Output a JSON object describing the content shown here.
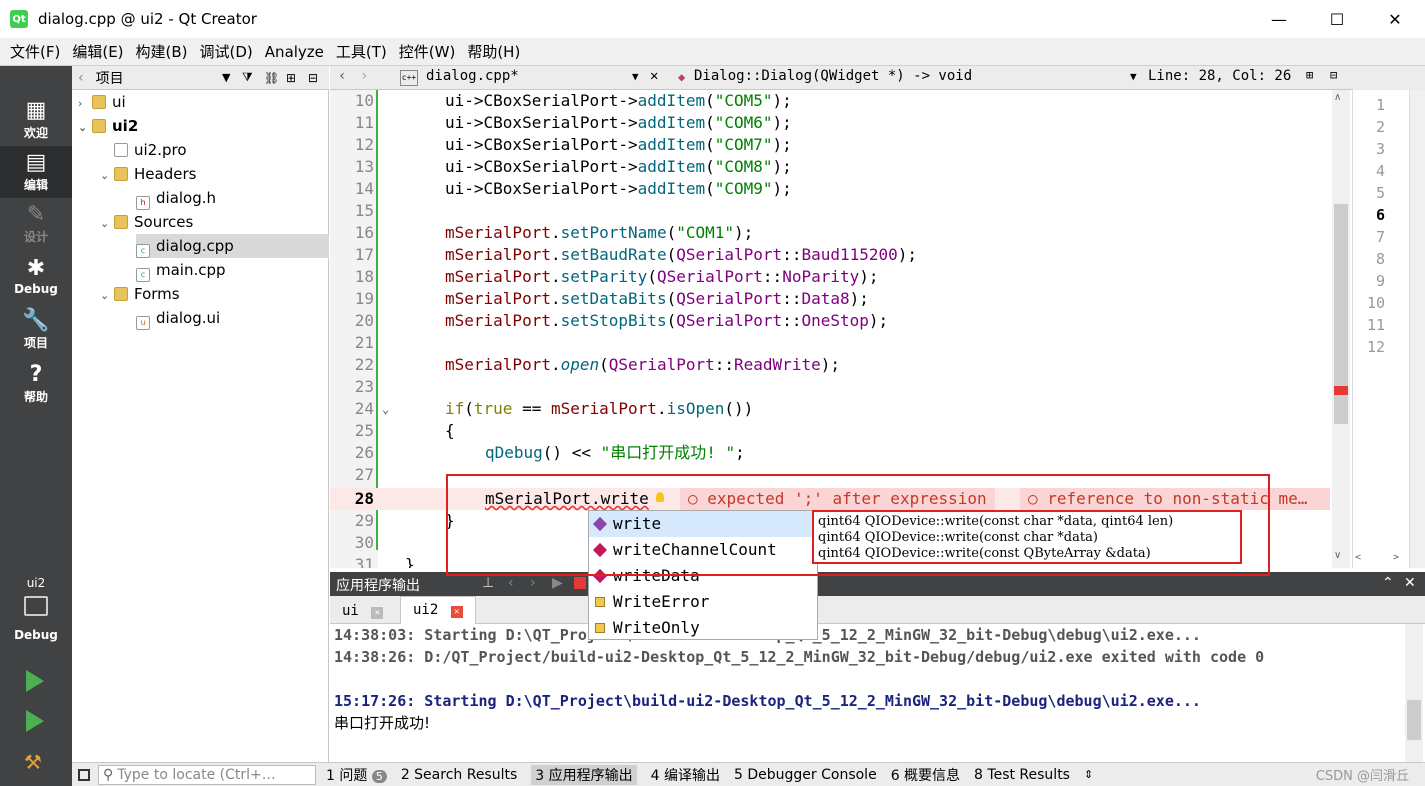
{
  "window": {
    "title": "dialog.cpp @ ui2 - Qt Creator",
    "logo_text": "Qt",
    "minimize": "—",
    "maximize": "☐",
    "close": "✕"
  },
  "menu": [
    "文件(F)",
    "编辑(E)",
    "构建(B)",
    "调试(D)",
    "Analyze",
    "工具(T)",
    "控件(W)",
    "帮助(H)"
  ],
  "modes": [
    {
      "icon": "▦",
      "label": "欢迎"
    },
    {
      "icon": "▤",
      "label": "编辑"
    },
    {
      "icon": "✎",
      "label": "设计"
    },
    {
      "icon": "✱",
      "label": "Debug"
    },
    {
      "icon": "🔧",
      "label": "项目"
    },
    {
      "icon": "?",
      "label": "帮助"
    }
  ],
  "kit": {
    "project": "ui2",
    "config": "Debug"
  },
  "project_panel": {
    "title": "项目"
  },
  "tree": [
    {
      "label": "ui",
      "arrow": "›",
      "type": "folder"
    },
    {
      "label": "ui2",
      "arrow": "⌄",
      "type": "folder"
    },
    {
      "label": "ui2.pro",
      "arrow": "",
      "type": "pro"
    },
    {
      "label": "Headers",
      "arrow": "⌄",
      "type": "folder"
    },
    {
      "label": "dialog.h",
      "arrow": "",
      "type": "h"
    },
    {
      "label": "Sources",
      "arrow": "⌄",
      "type": "folder"
    },
    {
      "label": "dialog.cpp",
      "arrow": "",
      "type": "cpp"
    },
    {
      "label": "main.cpp",
      "arrow": "",
      "type": "cpp"
    },
    {
      "label": "Forms",
      "arrow": "⌄",
      "type": "folder"
    },
    {
      "label": "dialog.ui",
      "arrow": "",
      "type": "ui"
    }
  ],
  "editor": {
    "file": "dialog.cpp*",
    "function": "Dialog::Dialog(QWidget *) -> void",
    "position": "Line: 28, Col: 26",
    "line_numbers": [
      "10",
      "11",
      "12",
      "13",
      "14",
      "15",
      "16",
      "17",
      "18",
      "19",
      "20",
      "21",
      "22",
      "23",
      "24",
      "25",
      "26",
      "27",
      "28",
      "29",
      "30",
      "31"
    ],
    "diag1": "expected ';' after expression",
    "diag2": "reference to non-static me…"
  },
  "minimap_lines": [
    "1",
    "2",
    "3",
    "4",
    "5",
    "6",
    "7",
    "8",
    "9",
    "10",
    "11",
    "12"
  ],
  "completion": {
    "items": [
      "write",
      "writeChannelCount",
      "writeData",
      "WriteError",
      "WriteOnly"
    ],
    "signatures": [
      "qint64 QIODevice::write(const char *data, qint64 len)",
      "qint64 QIODevice::write(const char *data)",
      "qint64 QIODevice::write(const QByteArray &data)"
    ]
  },
  "output": {
    "title": "应用程序输出",
    "tabs": [
      {
        "label": "ui"
      },
      {
        "label": "ui2"
      }
    ],
    "lines": [
      "14:38:03: Starting D:\\QT_Project\\build-ui2-Desktop_Qt_5_12_2_MinGW_32_bit-Debug\\debug\\ui2.exe...",
      "14:38:26: D:/QT_Project/build-ui2-Desktop_Qt_5_12_2_MinGW_32_bit-Debug/debug/ui2.exe exited with code 0",
      "15:17:26: Starting D:\\QT_Project\\build-ui2-Desktop_Qt_5_12_2_MinGW_32_bit-Debug\\debug\\ui2.exe...",
      "串口打开成功!"
    ]
  },
  "status": {
    "locate_placeholder": "Type to locate (Ctrl+…",
    "items": [
      "1 问题",
      "2 Search Results",
      "3 应用程序输出",
      "4 编译输出",
      "5 Debugger Console",
      "6 概要信息",
      "8 Test Results"
    ],
    "problem_count": "5",
    "watermark": "CSDN @闫滑丘"
  },
  "colors": {
    "accent_box": "#e02020",
    "sidebar": "#404244",
    "keyword": "#808000",
    "function": "#00677c",
    "string": "#008000"
  }
}
